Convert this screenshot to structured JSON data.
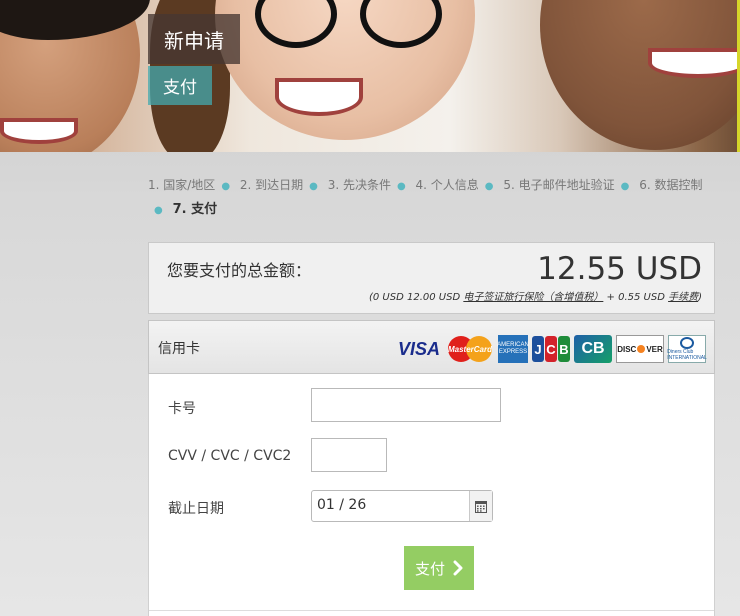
{
  "hero": {
    "title": "新申请",
    "subtitle": "支付"
  },
  "steps": [
    {
      "label": "1. 国家/地区"
    },
    {
      "label": "2. 到达日期"
    },
    {
      "label": "3. 先决条件"
    },
    {
      "label": "4. 个人信息"
    },
    {
      "label": "5. 电子邮件地址验证"
    },
    {
      "label": "6. 数据控制"
    },
    {
      "label": "7. 支付",
      "current": true
    }
  ],
  "total": {
    "label": "您要支付的总金额：",
    "amount": "12.55 USD",
    "breakdown": {
      "prefix": "(0 USD 12.00 USD",
      "insurance_link": "电子签证旅行保险（含增值税）",
      "middle": "+ 0.55 USD",
      "fee_link": "手续费",
      "suffix": ")"
    }
  },
  "card": {
    "header_label": "信用卡",
    "logos": {
      "visa": "VISA",
      "mastercard": "MasterCard",
      "amex": "AMERICAN EXPRESS",
      "jcb": [
        "J",
        "C",
        "B"
      ],
      "cb": "CB",
      "discover_a": "DISC",
      "discover_b": "VER",
      "diners": "Diners Club INTERNATIONAL"
    },
    "fields": {
      "card_number_label": "卡号",
      "card_number_value": "",
      "cvv_label": "CVV / CVC / CVC2",
      "cvv_value": "",
      "expiry_label": "截止日期",
      "expiry_value": "01 / 26"
    },
    "pay_button": "支付"
  },
  "colors": {
    "accent_teal": "#43aaaf",
    "pay_green": "#94cd63",
    "step_dot": "#5bb9c2"
  }
}
